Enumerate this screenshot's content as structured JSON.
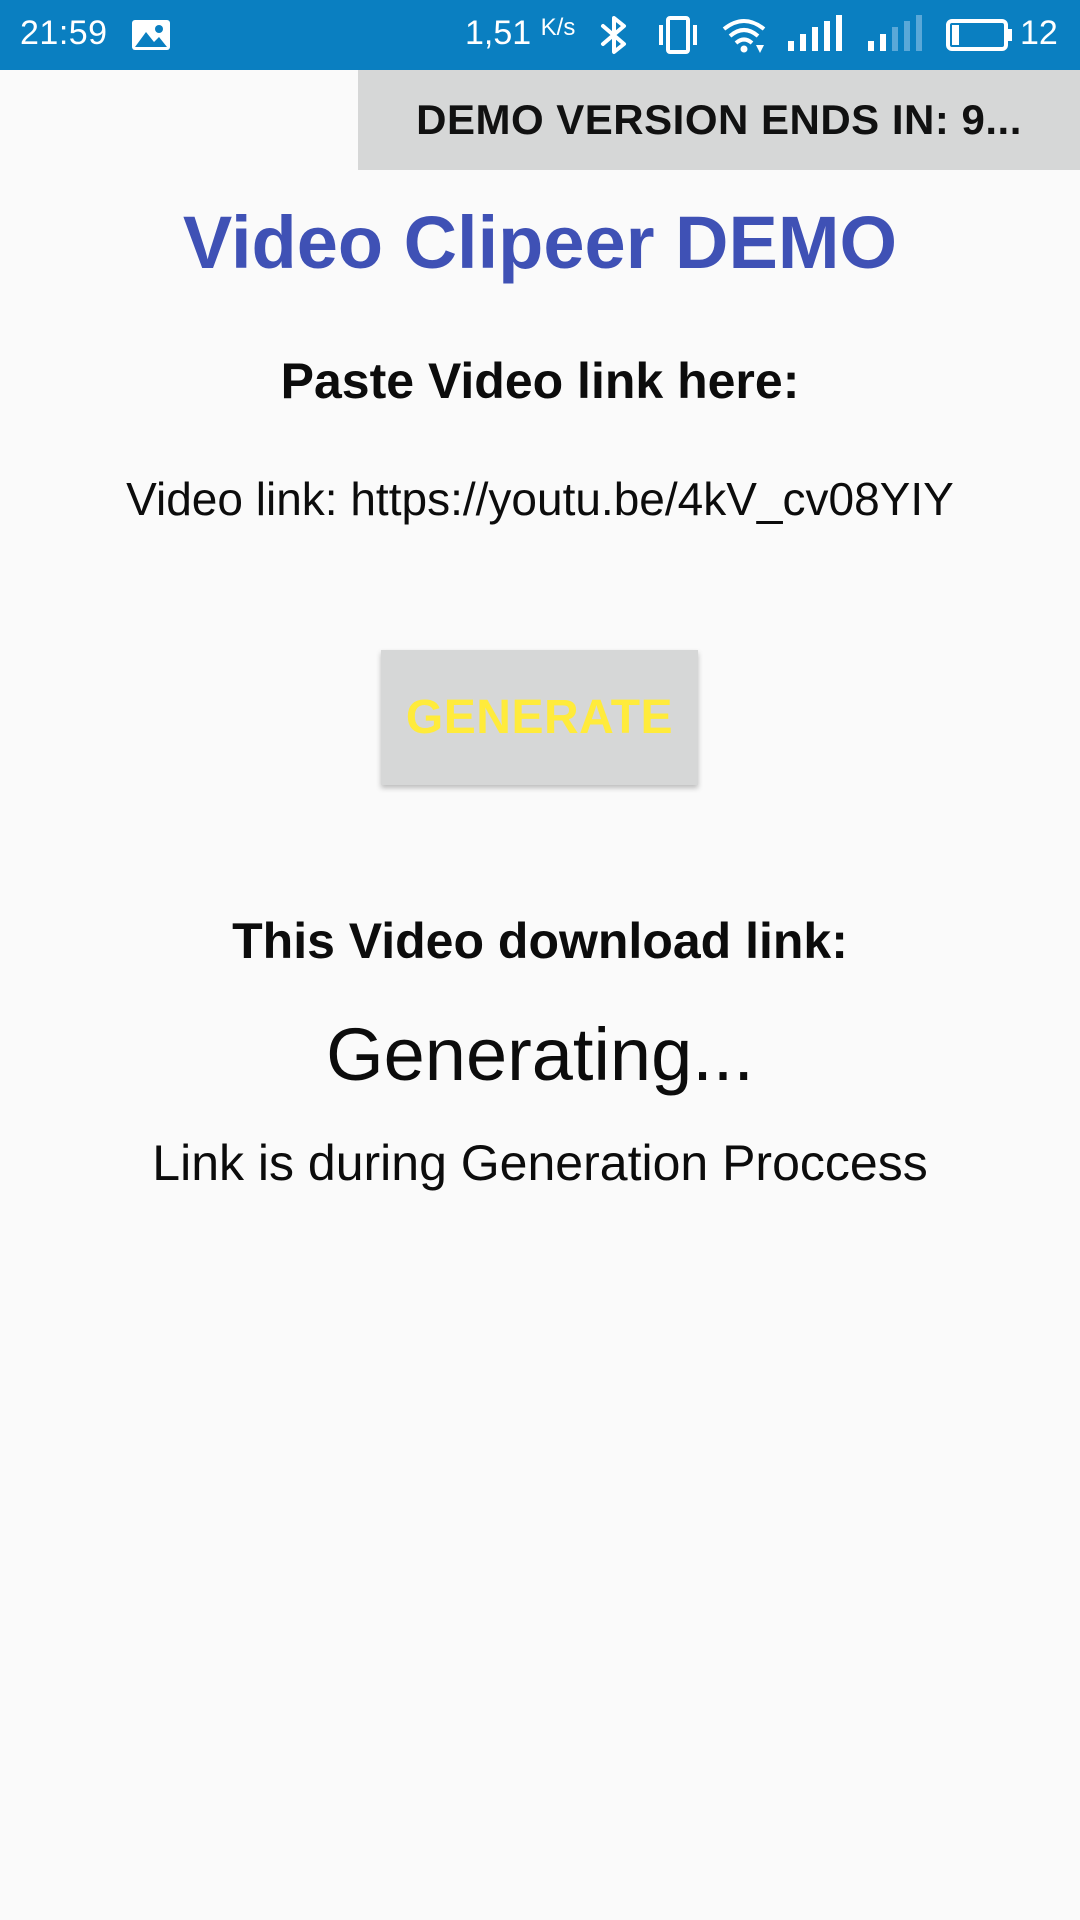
{
  "status_bar": {
    "time": "21:59",
    "network_speed": "1,51",
    "network_speed_unit": "K/s",
    "battery_percent": "12",
    "icons": [
      "gallery-icon",
      "bluetooth-icon",
      "vibrate-icon",
      "wifi-icon",
      "signal-3g-icon",
      "signal-weak-icon",
      "battery-icon"
    ]
  },
  "banner": {
    "text": "DEMO VERSION ENDS IN: 9..."
  },
  "app": {
    "title": "Video Clipeer DEMO",
    "paste_heading": "Paste Video link here:",
    "video_link": "Video link: https://youtu.be/4kV_cv08YIY",
    "generate_button": "GENERATE",
    "download_heading": "This Video download link:",
    "status": "Generating...",
    "status_detail": "Link is during Generation Proccess"
  },
  "colors": {
    "status_bar": "#0a7fc1",
    "title": "#3f51b5",
    "button_bg": "#d6d7d7",
    "button_text": "#ffeb3b",
    "background": "#fafafa"
  }
}
